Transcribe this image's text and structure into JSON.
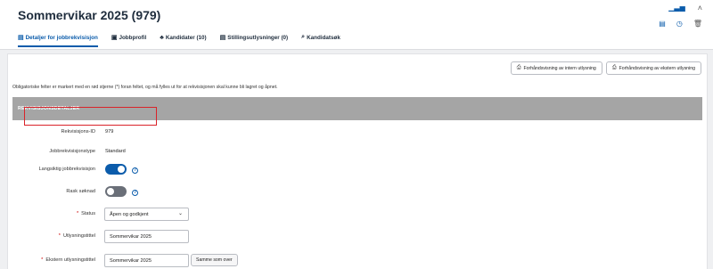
{
  "header": {
    "title": "Sommervikar 2025",
    "title_count": "(979)",
    "tabs": [
      {
        "label": "Detaljer for jobbrekvisisjon",
        "icon": "▤",
        "active": true
      },
      {
        "label": "Jobbprofil",
        "icon": "▣",
        "active": false
      },
      {
        "label": "Kandidater (10)",
        "icon": "♣",
        "active": false
      },
      {
        "label": "Stillingsutlysninger (0)",
        "icon": "▤",
        "active": false
      },
      {
        "label": "Kandidatsøk",
        "icon": "⌕",
        "active": false
      }
    ],
    "top_icons": {
      "chart": "bar-chart-icon",
      "collapse": "chevron-up-icon"
    },
    "action_icons": [
      "clipboard-icon",
      "clock-icon",
      "trash-icon"
    ]
  },
  "panel": {
    "preview_buttons": [
      {
        "label": "Forhåndsvisning av intern utlysning",
        "icon": "printer-icon"
      },
      {
        "label": "Forhåndsvisning av ekstern utlysning",
        "icon": "printer-icon"
      }
    ],
    "info_text": "Obligatoriske felter er markert med en rød stjerne (*) foran feltet, og må fylles ut for at rekvisisjonen skal kunne bli lagret og åpnet.",
    "section_title": "REKVISISJONSDETALJER",
    "fields": {
      "req_id": {
        "label": "Rekvisisjons-ID",
        "value": "979"
      },
      "req_type": {
        "label": "Jobbrekvisisjonstype",
        "value": "Standard"
      },
      "long_term": {
        "label": "Langsiktig jobbrekvisisjon",
        "on": true
      },
      "quick_apply": {
        "label": "Rask søknad",
        "on": false
      },
      "status": {
        "label": "Status",
        "value": "Åpen og godkjent",
        "required": "*"
      },
      "posting_title": {
        "label": "Utlysningstittel",
        "value": "Sommervikar 2025",
        "required": "*"
      },
      "external_title": {
        "label": "Ekstern utlysningstittel",
        "value": "Sommervikar 2025",
        "required": "*",
        "same_button": "Samme som over"
      }
    }
  },
  "colors": {
    "accent": "#0b5cab",
    "section_bg": "#a5a5a5",
    "highlight": "#d9232a",
    "required": "#cc0000"
  }
}
